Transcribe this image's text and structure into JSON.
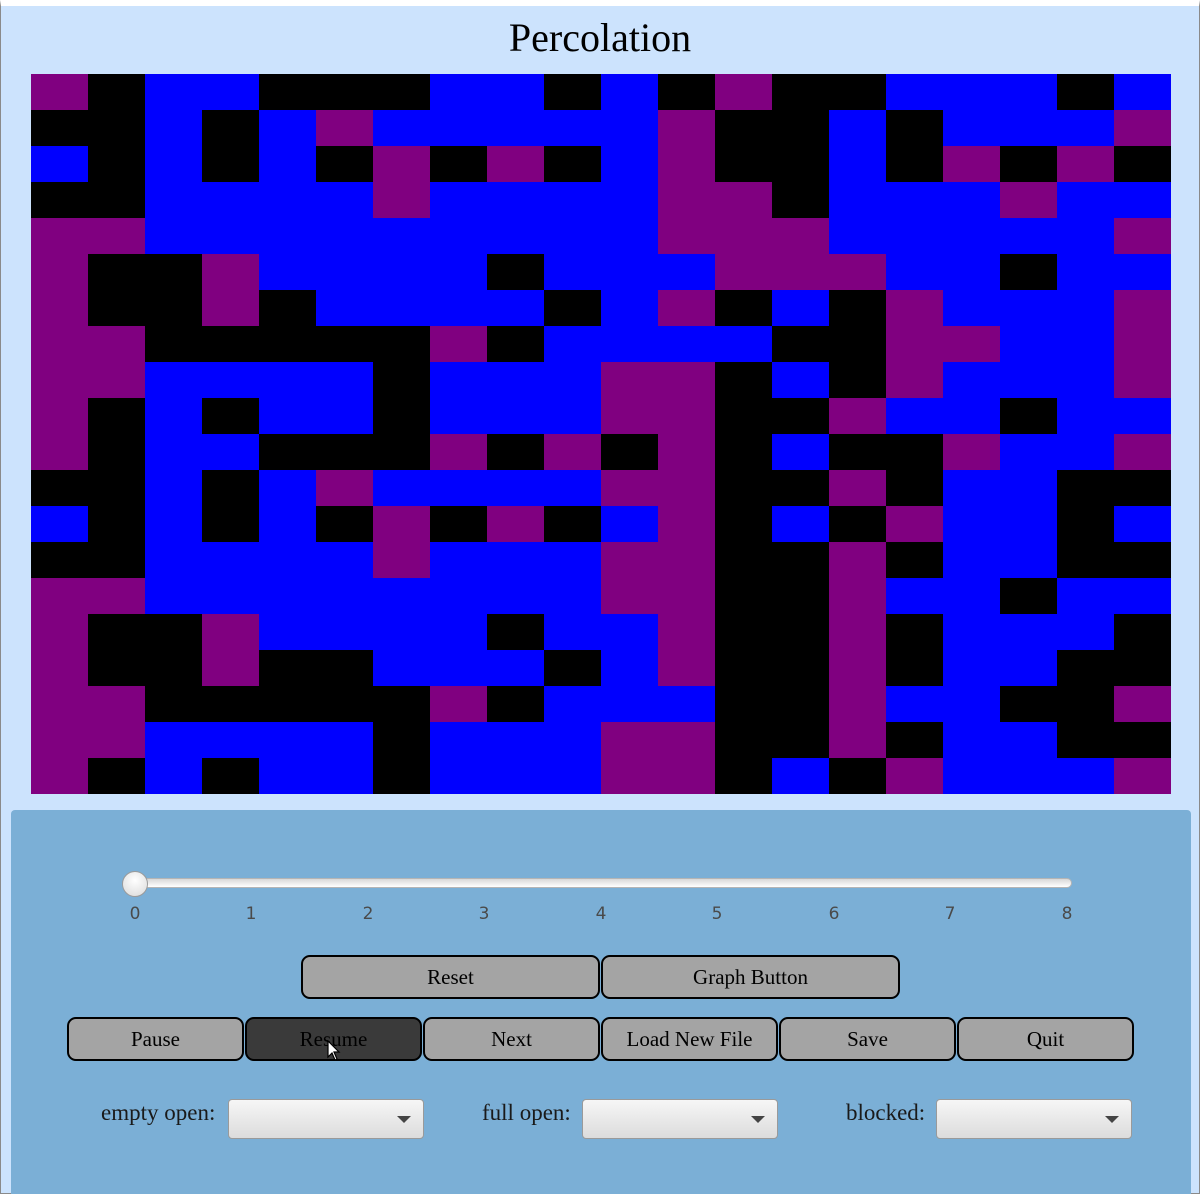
{
  "window": {
    "title": "Percolation"
  },
  "grid": {
    "rows": 20,
    "cols": 20,
    "legend": {
      "0": "blocked",
      "1": "full open",
      "2": "empty open"
    },
    "colors": {
      "blocked": "#000000",
      "full_open": "#0000ff",
      "empty_open": "#800080"
    },
    "cells": [
      "20110001101020011101",
      "00101211111200101112",
      "10101020201200102020",
      "00111121111220111211",
      "22111111111222111112",
      "20021111011122211011",
      "20020111101201021112",
      "22000002011110022112",
      "22111101112201021112",
      "20101101112200211011",
      "20110002020201002112",
      "00101211112200201100",
      "10101020201201021101",
      "00111121112200201100",
      "22111111112200211011",
      "20021111011200201110",
      "20020011101200201100",
      "22000002011100211002",
      "22111101112200201100",
      "20101101112201021112"
    ]
  },
  "slider": {
    "value": 0,
    "min": 0,
    "max": 8,
    "ticks": [
      "0",
      "1",
      "2",
      "3",
      "4",
      "5",
      "6",
      "7",
      "8"
    ]
  },
  "buttons": {
    "reset": "Reset",
    "graph": "Graph Button",
    "pause": "Pause",
    "resume": "Resume",
    "next": "Next",
    "load": "Load New File",
    "save": "Save",
    "quit": "Quit"
  },
  "color_selectors": {
    "empty_open_label": "empty open:",
    "full_open_label": "full open:",
    "blocked_label": "blocked:"
  }
}
